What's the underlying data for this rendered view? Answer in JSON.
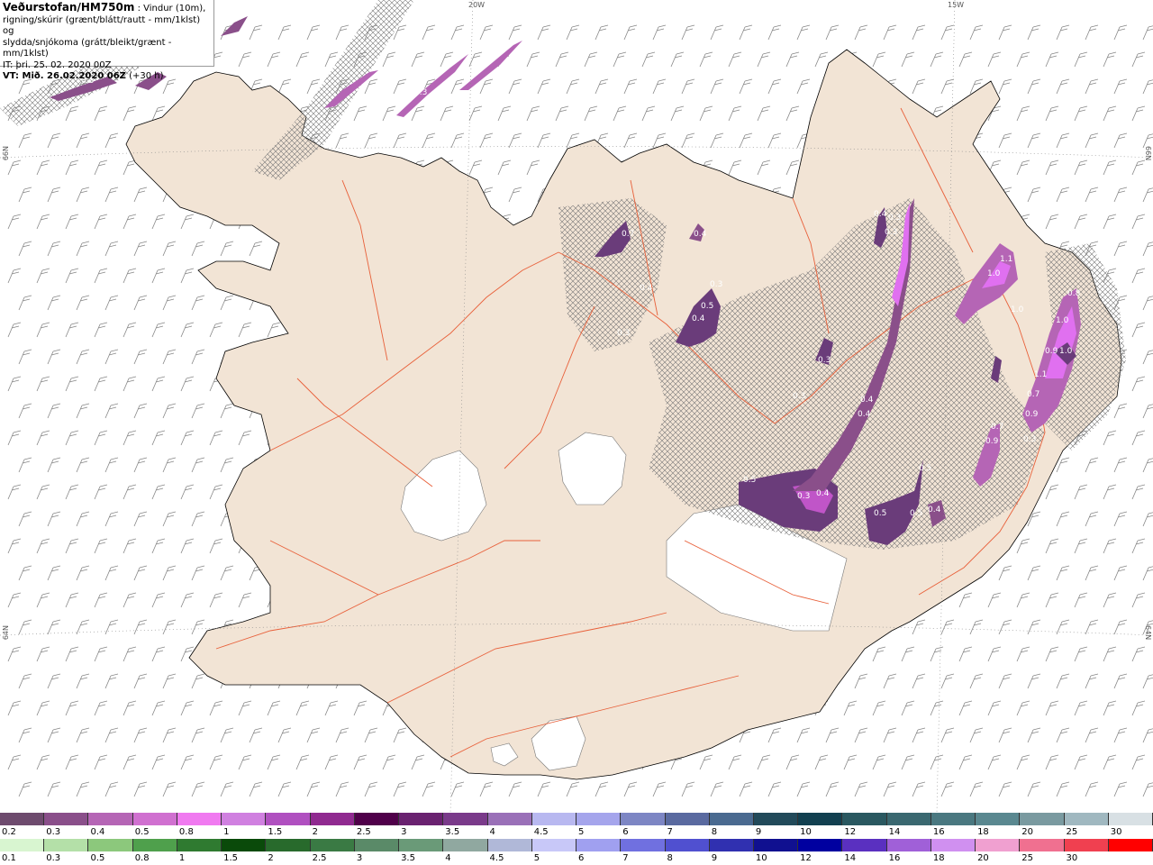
{
  "header": {
    "title": "Veðurstofan/HM750m",
    "line1_rest": " : Vindur (10m),",
    "line2": "rigning/skúrir (grænt/blátt/rautt - mm/1klst) og",
    "line3": "slydda/snjókoma (grátt/bleikt/grænt - mm/1klst)",
    "line4": "IT: þri. 25. 02. 2020 00Z",
    "line5_bold": "VT: Mið. 26.02.2020 06Z",
    "line5_rest": " (+30 h)"
  },
  "grid_labels": {
    "top_20w": "20W",
    "top_15w": "15W",
    "left_66n": "66N",
    "left_64n": "64N",
    "right_66n": "66N",
    "right_64n": "64N"
  },
  "colors": {
    "land": "#f2e4d5",
    "sea": "#ffffff",
    "roads": "#e8603a",
    "snow_precip": "#6a3c7a",
    "snow_light": "#c055c8",
    "snow_heavy": "#e070f0",
    "barbs": "#888888"
  },
  "precip_labels": [
    "0.3",
    "0.7",
    "0.4",
    "0.3",
    "0.4",
    "0.5",
    "0.4",
    "0.3",
    "0.3",
    "0.3",
    "0.4",
    "0.4",
    "0.4",
    "0.3",
    "0.3",
    "0.5",
    "0.4",
    "0.5",
    "0.5",
    "0.4",
    "1.0",
    "1.1",
    "1.0",
    "0.8",
    "1.0",
    "1.0",
    "0.9",
    "1.1",
    "0.9",
    "0.7",
    "0.9",
    "0.7",
    "0.5",
    "0.3",
    "0.3",
    "0.3"
  ],
  "legend_snow": {
    "labels": [
      "0.2",
      "0.3",
      "0.4",
      "0.5",
      "0.8",
      "1",
      "1.5",
      "2",
      "2.5",
      "3",
      "3.5",
      "4",
      "4.5",
      "5",
      "6",
      "7",
      "8",
      "9",
      "10",
      "12",
      "14",
      "16",
      "18",
      "20",
      "25",
      "30"
    ],
    "colors": [
      "#6e4b6e",
      "#8a4f8a",
      "#b565b5",
      "#d070d0",
      "#f07af0",
      "#d080e0",
      "#b050c0",
      "#902a90",
      "#50004a",
      "#6a2270",
      "#7a3a8a",
      "#9a70b8",
      "#b8b8f0",
      "#a5a5ec",
      "#7d86c4",
      "#5a6aa0",
      "#4a6a90",
      "#224a5a",
      "#124050",
      "#2a5860",
      "#3a6870",
      "#4a7880",
      "#5a8890",
      "#7a9aa0",
      "#a0b8c0",
      "#d8e0e4"
    ]
  },
  "legend_rain": {
    "labels": [
      "0.1",
      "0.3",
      "0.5",
      "0.8",
      "1",
      "1.5",
      "2",
      "2.5",
      "3",
      "3.5",
      "4",
      "4.5",
      "5",
      "6",
      "7",
      "8",
      "9",
      "10",
      "12",
      "14",
      "16",
      "18",
      "20",
      "25",
      "30"
    ],
    "colors": [
      "#d8f5d0",
      "#b4e0a8",
      "#8cc87c",
      "#4fa04c",
      "#2f7a30",
      "#0a4a0a",
      "#286a2c",
      "#3a7a44",
      "#5a8a68",
      "#6a9a78",
      "#90a8a0",
      "#b0b8d8",
      "#c8c8f8",
      "#a0a0f0",
      "#7070e0",
      "#5050d0",
      "#3030b0",
      "#101090",
      "#0000a0",
      "#5a30c0",
      "#a060d8",
      "#d090f0",
      "#f0a0d0",
      "#f07090",
      "#f04050",
      "#ff0000"
    ]
  }
}
